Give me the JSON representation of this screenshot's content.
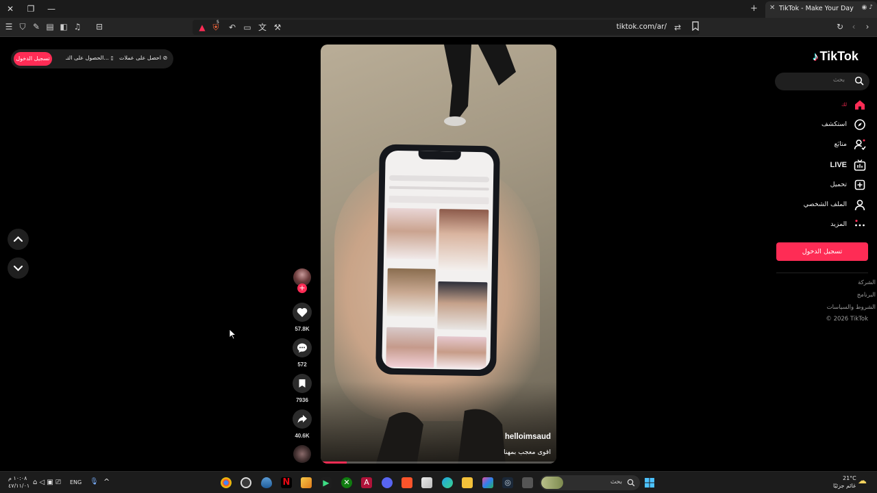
{
  "browser": {
    "tab_title": "TikTok - Make Your Day",
    "url": "tiktok.com/ar/",
    "tab_badge": "5"
  },
  "sidebar": {
    "logo": "TikTok",
    "search_placeholder": "بحث",
    "nav": [
      {
        "label": "لك",
        "icon": "home-icon",
        "active": true
      },
      {
        "label": "استكشف",
        "icon": "compass-icon"
      },
      {
        "label": "متابَع",
        "icon": "following-icon"
      },
      {
        "label": "LIVE",
        "icon": "live-icon"
      },
      {
        "label": "تحميل",
        "icon": "upload-icon"
      },
      {
        "label": "الملف الشخصي",
        "icon": "profile-icon"
      },
      {
        "label": "المزيد",
        "icon": "more-icon"
      }
    ],
    "login_button": "تسجيل الدخول",
    "footer": [
      "الشركة",
      "البرنامج",
      "الشروط والسياسات",
      "© 2026 TikTok"
    ]
  },
  "top_pill": {
    "login": "تسجيل الدخول",
    "get_app": "الحصول على التـ...",
    "get_coins": "احصل على عملات"
  },
  "video": {
    "author": "helloimsaud",
    "caption": "اقوى معجب  بمهنا",
    "progress": 0.11
  },
  "actions": {
    "likes": "57.8K",
    "comments": "572",
    "saves": "7936",
    "shares": "40.6K"
  },
  "taskbar": {
    "time": "١٠:٠٨ م",
    "date": "٤٧/١١/٠١",
    "language": "ENG",
    "search_placeholder": "بحث",
    "weather_temp": "21°C",
    "weather_desc": "غائم جزئيًا"
  },
  "colors": {
    "accent": "#fe2c55",
    "background": "#000000"
  }
}
